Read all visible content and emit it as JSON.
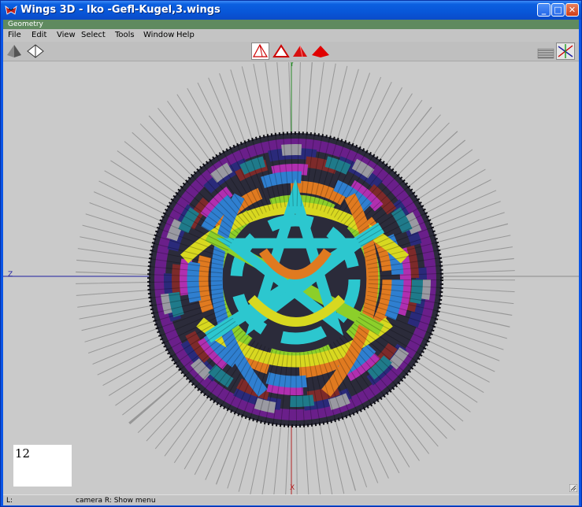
{
  "window": {
    "title": "Wings 3D - Iko -Gefl-Kugel,3.wings",
    "minimize_glyph": "_",
    "maximize_glyph": "□",
    "close_glyph": "✕"
  },
  "geometry_title": "Geometry",
  "menu": [
    "File",
    "Edit",
    "View",
    "Select",
    "Tools",
    "Window",
    "Help"
  ],
  "toolbar": {
    "left_icons": [
      "smooth-shading-icon",
      "wireframe-shading-icon"
    ],
    "center_icons": [
      "vertex-select-icon",
      "edge-select-icon",
      "face-select-icon",
      "body-select-icon"
    ],
    "right_icons": [
      "groundplane-icon",
      "axes-icon"
    ]
  },
  "viewport": {
    "axis_y_label": "Y",
    "axis_z_label": "Z",
    "axis_x_label": "X"
  },
  "status": {
    "text": "L: Select   M: Tumble camera   R: Show menu",
    "text_visible": "camera   R: Show menu",
    "left_fragment": "L:"
  },
  "counter": "12",
  "colors": {
    "title_bar": "#0856d8",
    "geometry_bar": "#5f8a5f",
    "viewport_bg": "#cacaca",
    "axis_y": "#2a8a2a",
    "axis_z": "#1e1ea0",
    "axis_x": "#b22222"
  }
}
